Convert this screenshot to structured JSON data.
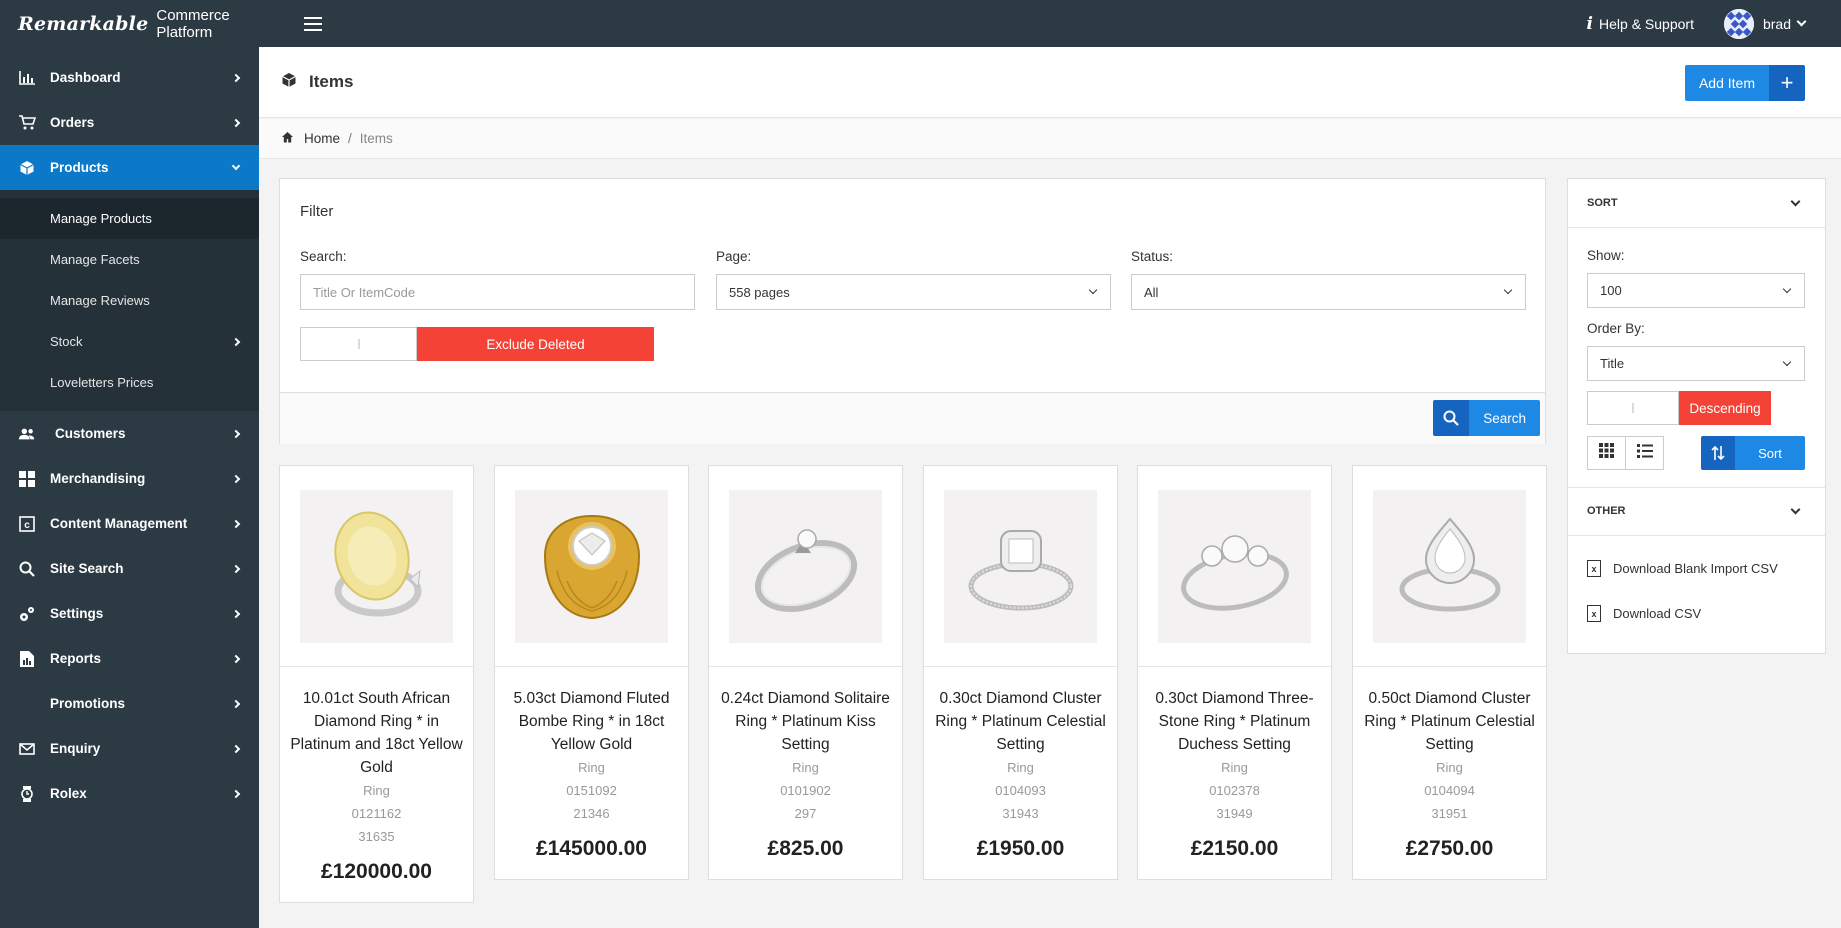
{
  "topbar": {
    "brand_logo": "Remarkable",
    "brand_sub": "Commerce Platform",
    "help_label": "Help & Support",
    "user_name": "brad"
  },
  "sidebar": {
    "items": [
      {
        "label": "Dashboard",
        "icon": "bar-chart-icon"
      },
      {
        "label": "Orders",
        "icon": "cart-icon"
      },
      {
        "label": "Products",
        "icon": "cube-icon"
      },
      {
        "label": "Customers",
        "icon": "users-icon"
      },
      {
        "label": "Merchandising",
        "icon": "grid-icon"
      },
      {
        "label": "Content Management",
        "icon": "content-icon"
      },
      {
        "label": "Site Search",
        "icon": "search-icon"
      },
      {
        "label": "Settings",
        "icon": "gears-icon"
      },
      {
        "label": "Reports",
        "icon": "report-icon"
      },
      {
        "label": "Promotions",
        "icon": ""
      },
      {
        "label": "Enquiry",
        "icon": "envelope-icon"
      },
      {
        "label": "Rolex",
        "icon": "rolex-icon"
      }
    ],
    "sub_items": [
      {
        "label": "Manage Products"
      },
      {
        "label": "Manage Facets"
      },
      {
        "label": "Manage Reviews"
      },
      {
        "label": "Stock"
      },
      {
        "label": "Loveletters Prices"
      }
    ]
  },
  "header": {
    "title": "Items",
    "add_button_label": "Add Item",
    "add_button_plus": "+"
  },
  "breadcrumb": {
    "home": "Home",
    "separator": "/",
    "current": "Items"
  },
  "filter": {
    "title": "Filter",
    "search_label": "Search:",
    "search_placeholder": "Title Or ItemCode",
    "page_label": "Page:",
    "page_value": "558 pages",
    "status_label": "Status:",
    "status_value": "All",
    "exclude_deleted_label": "Exclude Deleted",
    "search_button_label": "Search"
  },
  "products": [
    {
      "title": "10.01ct South African Diamond Ring * in Platinum and 18ct Yellow Gold",
      "type": "Ring",
      "code": "0121162",
      "id": "31635",
      "price": "£120000.00"
    },
    {
      "title": "5.03ct Diamond Fluted Bombe Ring * in 18ct Yellow Gold",
      "type": "Ring",
      "code": "0151092",
      "id": "21346",
      "price": "£145000.00"
    },
    {
      "title": "0.24ct Diamond Solitaire Ring * Platinum Kiss Setting",
      "type": "Ring",
      "code": "0101902",
      "id": "297",
      "price": "£825.00"
    },
    {
      "title": "0.30ct Diamond Cluster Ring * Platinum Celestial Setting",
      "type": "Ring",
      "code": "0104093",
      "id": "31943",
      "price": "£1950.00"
    },
    {
      "title": "0.30ct Diamond Three-Stone Ring * Platinum Duchess Setting",
      "type": "Ring",
      "code": "0102378",
      "id": "31949",
      "price": "£2150.00"
    },
    {
      "title": "0.50ct Diamond Cluster Ring * Platinum Celestial Setting",
      "type": "Ring",
      "code": "0104094",
      "id": "31951",
      "price": "£2750.00"
    }
  ],
  "sort_panel": {
    "sort_heading": "SORT",
    "show_label": "Show:",
    "show_value": "100",
    "order_by_label": "Order By:",
    "order_by_value": "Title",
    "direction_label": "Descending",
    "sort_button_label": "Sort",
    "other_heading": "OTHER",
    "download_blank_label": "Download Blank Import CSV",
    "download_csv_label": "Download CSV"
  },
  "colors": {
    "topbar": "#2c3a44",
    "sidebar_active": "#0b79c7",
    "primary": "#1e88e5",
    "primary_dark": "#1565c0",
    "danger": "#f44336"
  }
}
